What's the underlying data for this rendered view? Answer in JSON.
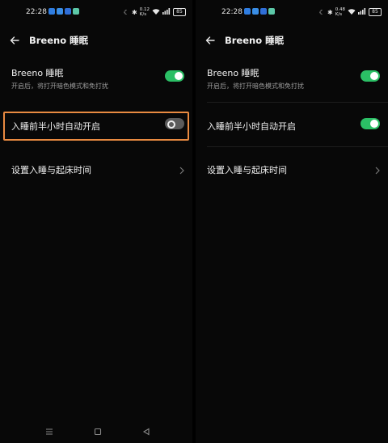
{
  "left": {
    "status": {
      "time": "22:28",
      "net_speed_top": "0.12",
      "net_speed_bottom": "K/s",
      "battery": "85"
    },
    "header": {
      "title": "Breeno 睡眠"
    },
    "settings": {
      "breeno_sleep": {
        "title": "Breeno 睡眠",
        "subtitle": "开启后，将打开暗色模式和免打扰",
        "enabled": true
      },
      "auto_on": {
        "title": "入睡前半小时自动开启",
        "enabled": false
      },
      "schedule": {
        "title": "设置入睡与起床时间"
      }
    }
  },
  "right": {
    "status": {
      "time": "22:28",
      "net_speed_top": "0.48",
      "net_speed_bottom": "K/s",
      "battery": "85"
    },
    "header": {
      "title": "Breeno 睡眠"
    },
    "settings": {
      "breeno_sleep": {
        "title": "Breeno 睡眠",
        "subtitle": "开启后，将打开暗色模式和免打扰",
        "enabled": true
      },
      "auto_on": {
        "title": "入睡前半小时自动开启",
        "enabled": true
      },
      "schedule": {
        "title": "设置入睡与起床时间"
      }
    }
  },
  "colors": {
    "toggle_on": "#2bbf65",
    "toggle_off": "#5b5b5b",
    "highlight": "#e98a41",
    "background": "#080808"
  },
  "icons": {
    "back": "arrow-left-icon",
    "chevron": "chevron-right-icon",
    "nav_menu": "menu-icon",
    "nav_home": "square-icon",
    "nav_back": "triangle-back-icon"
  }
}
